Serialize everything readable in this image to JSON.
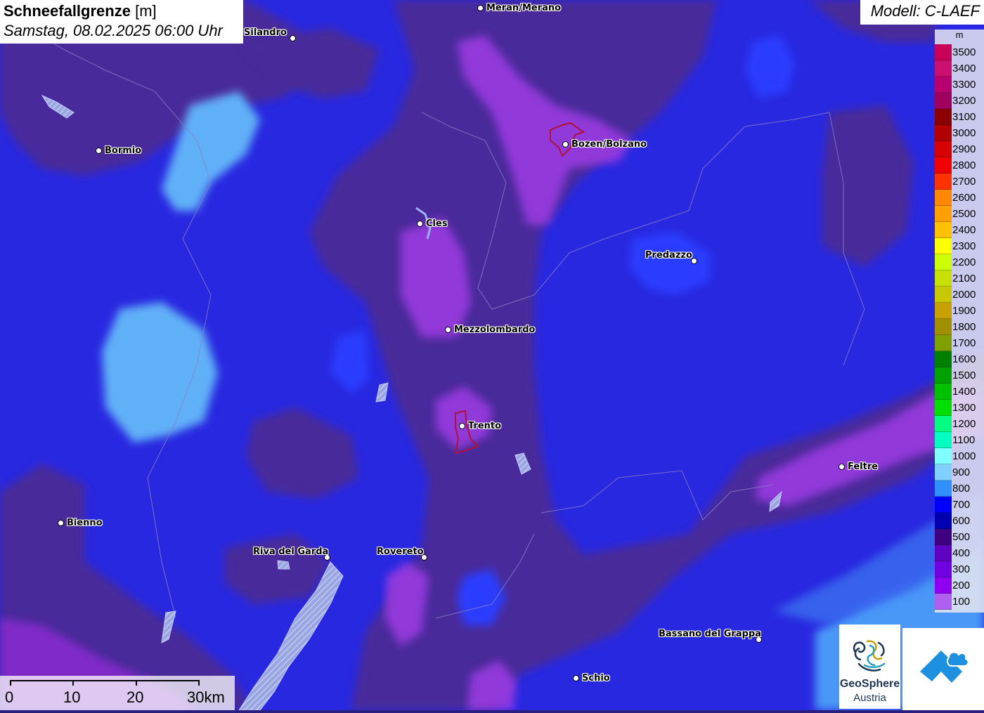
{
  "title": {
    "variable": "Schneefallgrenze",
    "unit": "[m]",
    "time": "Samstag, 08.02.2025 06:00 Uhr"
  },
  "model": "Modell: C-LAEF",
  "legend": {
    "unit": "m",
    "entries": [
      {
        "label": "3500",
        "color": "#c8005a"
      },
      {
        "label": "3400",
        "color": "#cc1070"
      },
      {
        "label": "3300",
        "color": "#b80070"
      },
      {
        "label": "3200",
        "color": "#a00060"
      },
      {
        "label": "3100",
        "color": "#8b0000"
      },
      {
        "label": "3000",
        "color": "#b20000"
      },
      {
        "label": "2900",
        "color": "#d60000"
      },
      {
        "label": "2800",
        "color": "#f00000"
      },
      {
        "label": "2700",
        "color": "#ff3300"
      },
      {
        "label": "2600",
        "color": "#ff8800"
      },
      {
        "label": "2500",
        "color": "#ffa000"
      },
      {
        "label": "2400",
        "color": "#ffc000"
      },
      {
        "label": "2300",
        "color": "#ffff00"
      },
      {
        "label": "2200",
        "color": "#ccff00"
      },
      {
        "label": "2100",
        "color": "#c8e000"
      },
      {
        "label": "2000",
        "color": "#c8c800"
      },
      {
        "label": "1900",
        "color": "#c8a000"
      },
      {
        "label": "1800",
        "color": "#a09000"
      },
      {
        "label": "1700",
        "color": "#80a000"
      },
      {
        "label": "1600",
        "color": "#008000"
      },
      {
        "label": "1500",
        "color": "#00a000"
      },
      {
        "label": "1400",
        "color": "#00c000"
      },
      {
        "label": "1300",
        "color": "#00e000"
      },
      {
        "label": "1200",
        "color": "#00ff80"
      },
      {
        "label": "1100",
        "color": "#00ffc0"
      },
      {
        "label": "1000",
        "color": "#80ffff"
      },
      {
        "label": "900",
        "color": "#80d0ff"
      },
      {
        "label": "800",
        "color": "#3090ff"
      },
      {
        "label": "700",
        "color": "#0000ff"
      },
      {
        "label": "600",
        "color": "#0000b0"
      },
      {
        "label": "500",
        "color": "#3c0080"
      },
      {
        "label": "400",
        "color": "#6000c0"
      },
      {
        "label": "300",
        "color": "#7000e0"
      },
      {
        "label": "200",
        "color": "#9000f0"
      },
      {
        "label": "100",
        "color": "#b060f0"
      }
    ]
  },
  "cities": [
    {
      "name": "Meran/Merano"
    },
    {
      "name": "Silandro"
    },
    {
      "name": "Bormio"
    },
    {
      "name": "Bozen/Bolzano"
    },
    {
      "name": "Cles"
    },
    {
      "name": "Predazzo"
    },
    {
      "name": "Mezzolombardo"
    },
    {
      "name": "Trento"
    },
    {
      "name": "Feltre"
    },
    {
      "name": "Bienno"
    },
    {
      "name": "Riva del Garda"
    },
    {
      "name": "Rovereto"
    },
    {
      "name": "Bassano del Grappa"
    },
    {
      "name": "Schio"
    }
  ],
  "scalebar": {
    "labels": [
      "0",
      "10",
      "20",
      "30km"
    ]
  },
  "logos": {
    "geosphere_line1": "GeoSphere",
    "geosphere_line2": "Austria"
  }
}
